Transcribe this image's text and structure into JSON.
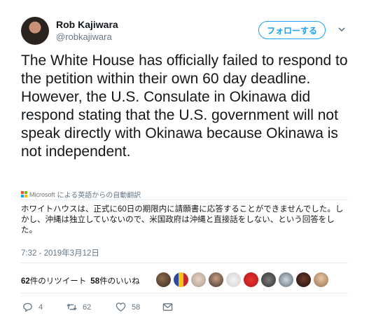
{
  "user": {
    "name": "Rob Kajiwara",
    "handle": "@robkajiwara"
  },
  "follow_label": "フォローする",
  "tweet_text": "The White House has officially failed to respond to the petition within their own 60 day deadline. However, the U.S. Consulate in Okinawa did respond stating that the U.S. government will not speak directly with Okinawa because Okinawa is not independent.",
  "translation": {
    "provider_word": "Microsoft",
    "header": "による英語からの自動翻訳",
    "text": "ホワイトハウスは、正式に60日の期限内に請願書に応答することができませんでした。しかし、沖縄は独立していないので、米国政府は沖縄と直接話をしない、という回答をした。"
  },
  "timestamp": "7:32 - 2019年3月12日",
  "stats": {
    "retweets_count": "62",
    "retweets_label": "件のリツイート",
    "likes_count": "58",
    "likes_label": "件のいいね"
  },
  "actions": {
    "replies": "4",
    "retweets": "62",
    "likes": "58"
  },
  "icons": [
    "chevron-down-icon",
    "microsoft-logo-icon",
    "reply-icon",
    "retweet-icon",
    "like-icon",
    "message-icon"
  ],
  "colors": {
    "accent": "#1da1f2",
    "muted": "#657786",
    "text": "#14171a",
    "divider": "#e6ecf0"
  }
}
